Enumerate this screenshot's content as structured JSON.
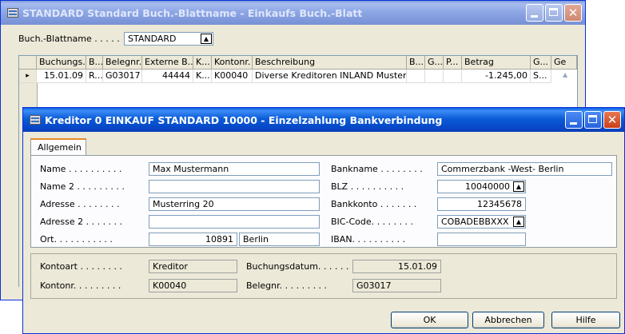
{
  "back_window": {
    "title": "STANDARD Standard Buch.-Blattname - Einkaufs Buch.-Blatt",
    "batch_label": "Buch.-Blattname . . . . .",
    "batch_value": "STANDARD",
    "columns": [
      "Buchungs...",
      "B...",
      "Belegnr.",
      "Externe B...",
      "K...",
      "Kontonr.",
      "Beschreibung",
      "B...",
      "G...",
      "P...",
      "Betrag",
      "G...",
      "Ge"
    ],
    "row": {
      "marker": "▸",
      "posting_date": "15.01.09",
      "doc_type": "R...",
      "doc_no": "G03017",
      "ext_doc_no": "44444",
      "account_type": "K...",
      "account_no": "K00040",
      "description": "Diverse Kreditoren INLAND Musterm...",
      "amount": "-1.245,00",
      "gen": "S..."
    }
  },
  "front_window": {
    "title": "Kreditor 0 EINKAUF STANDARD 10000 - Einzelzahlung Bankverbindung",
    "tab": "Allgemein",
    "fields": {
      "name_label": "Name . . . . . . . . . .",
      "name_value": "Max Mustermann",
      "name2_label": "Name 2 . . . . . . . . .",
      "name2_value": "",
      "address_label": "Adresse . . . . . . . .",
      "address_value": "Musterring 20",
      "address2_label": "Adresse 2 . . . . . . .",
      "address2_value": "",
      "city_label": "Ort. . . . . . . . . . .",
      "post_code_value": "10891",
      "city_value": "Berlin",
      "bank_name_label": "Bankname . . . . . . . .",
      "bank_name_value": "Commerzbank -West- Berlin",
      "blz_label": "BLZ . . . . . . . . . .",
      "blz_value": "10040000",
      "bank_account_label": "Bankkonto . . . . . . .",
      "bank_account_value": "12345678",
      "bic_label": "BIC-Code. . . . . . . .",
      "bic_value": "COBADEBBXXX",
      "iban_label": "IBAN. . . . . . . . . .",
      "iban_value": ""
    },
    "footer": {
      "account_type_label": "Kontoart . . . . . . . .",
      "account_type_value": "Kreditor",
      "account_no_label": "Kontonr. . . . . . . . .",
      "account_no_value": "K00040",
      "posting_date_label": "Buchungsdatum. . . . . .",
      "posting_date_value": "15.01.09",
      "doc_no_label": "Belegnr. . . . . . . . .",
      "doc_no_value": "G03017"
    },
    "buttons": {
      "ok": "OK",
      "cancel": "Abbrechen",
      "help": "Hilfe"
    }
  },
  "icons": {
    "lookup": "lookup-arrow-icon",
    "minimize": "minimize-icon",
    "maximize": "maximize-icon",
    "close": "close-icon"
  },
  "colors": {
    "titlebar_active": "#0a5fe0",
    "titlebar_inactive": "#8ea7e5",
    "window_bg": "#ece9d8",
    "tab_accent": "#e68b2c"
  }
}
